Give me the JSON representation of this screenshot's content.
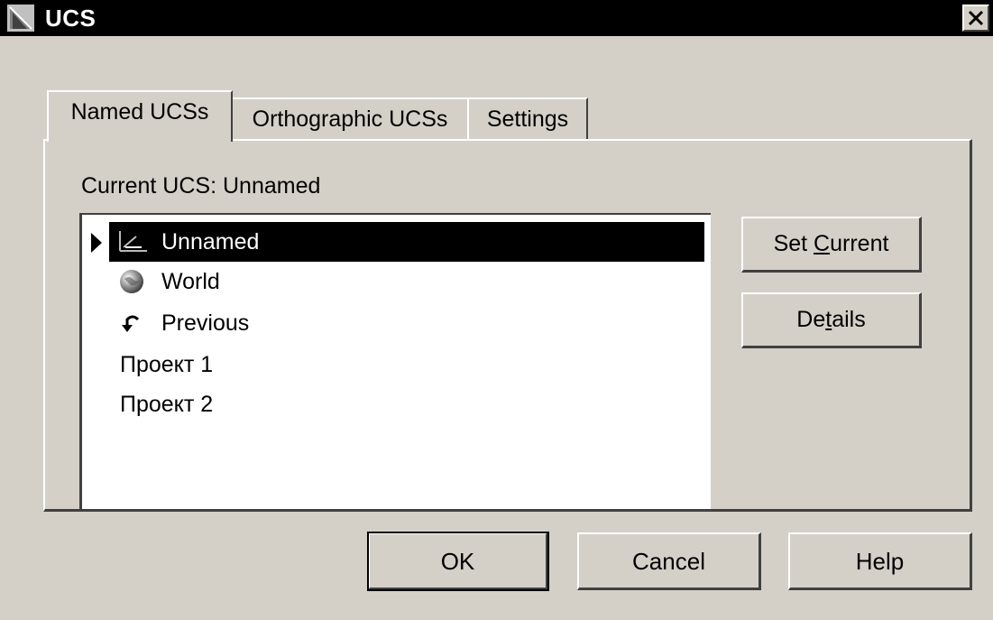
{
  "window": {
    "title": "UCS",
    "close_glyph": "×"
  },
  "tabs": [
    {
      "label": "Named UCSs",
      "active": true
    },
    {
      "label": "Orthographic UCSs",
      "active": false
    },
    {
      "label": "Settings",
      "active": false
    }
  ],
  "named_tab": {
    "current_label": "Current UCS:  Unnamed",
    "list": [
      {
        "label": "Unnamed",
        "icon": "ucs-axis-icon",
        "selected": true
      },
      {
        "label": "World",
        "icon": "globe-icon",
        "selected": false
      },
      {
        "label": "Previous",
        "icon": "undo-arrow-icon",
        "selected": false
      },
      {
        "label": "Проект 1",
        "icon": "",
        "selected": false
      },
      {
        "label": "Проект 2",
        "icon": "",
        "selected": false
      }
    ],
    "set_current": {
      "pre": "Set ",
      "hotkey": "C",
      "post": "urrent"
    },
    "details": {
      "pre": "De",
      "hotkey": "t",
      "post": "ails"
    }
  },
  "buttons": {
    "ok": "OK",
    "cancel": "Cancel",
    "help": "Help"
  },
  "colors": {
    "face": "#d4d0c8",
    "title_bar": "#000000",
    "selection": "#000000"
  }
}
